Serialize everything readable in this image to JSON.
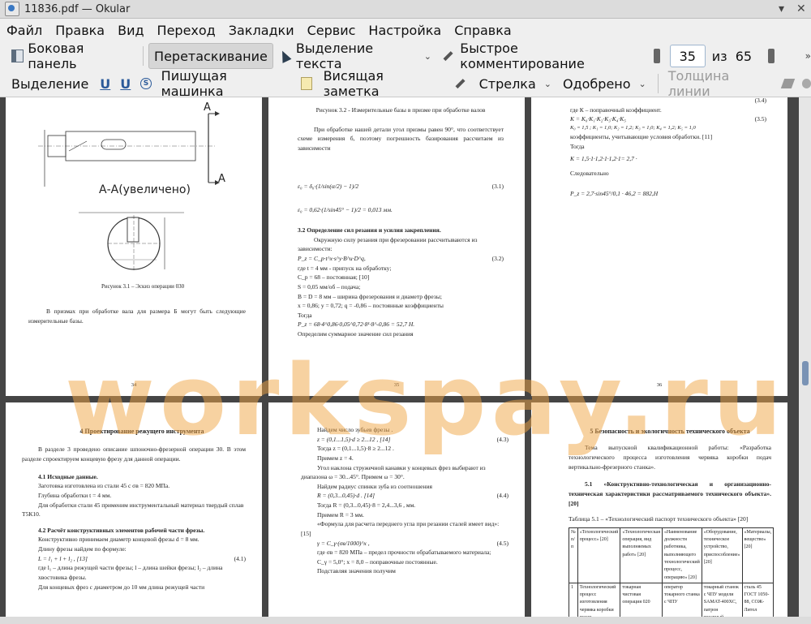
{
  "window": {
    "title": "11836.pdf — Okular"
  },
  "menu": [
    "Файл",
    "Правка",
    "Вид",
    "Переход",
    "Закладки",
    "Сервис",
    "Настройка",
    "Справка"
  ],
  "toolbar": {
    "sidebar": "Боковая панель",
    "browse": "Перетаскивание",
    "text_select": "Выделение текста",
    "quick_comment": "Быстрое комментирование",
    "page_current": "35",
    "page_of": "из",
    "page_total": "65"
  },
  "annotbar": {
    "select": "Выделение",
    "typewriter": "Пишущая машинка",
    "note": "Висящая заметка",
    "arrow": "Стрелка",
    "stamp": "Одобрено",
    "line_width": "Толщина линии"
  },
  "watermark": "workspay.ru",
  "pages": {
    "p34": {
      "number": "34",
      "section_label": "А",
      "section_title": "А-А(увеличено)",
      "caption": "Рисунок 3.1 – Эскиз операции 030",
      "text": "В призмах при обработке вала для размера Б могут быть следующие измерительные базы."
    },
    "p35": {
      "number": "35",
      "caption": "Рисунок 3.2 - Измерительные базы в призме при обработке валов",
      "para1": "При обработке нашей детали угол призмы равен 90°, что соответствует схеме измерения б, поэтому погрешность базирования рассчитаем из зависимости",
      "eq1_num": "(3.1)",
      "eq1_val": "ε₀ = 0,62·(1/sin45° − 1)/2 = 0,013 мм.",
      "heading": "3.2  Определение сил резания и усилия закрепления.",
      "para2": "Окружную силу резания при фрезеровании рассчитываются из зависимости:",
      "eq2_num": "(3.2)",
      "eq2": "P_z = C_p·t^x·s^y·B^u·D^q,",
      "list1": "где t = 4 мм - припуск на обработку;",
      "list2": "C_p = 68 – постоянная; [10]",
      "list3": "S = 0,05  мм/об – подача;",
      "list4": "B = D = 8 мм – ширина фрезерования и диаметр фрезы;",
      "list5": "x = 0,86; y = 0,72; q = -0,86 – постоянные коэффициенты",
      "then": "Тогда",
      "result": "P_z = 68·4^0,86·0,05^0,72·8¹·8^-0,86 = 52,7 Н.",
      "last": "Определим суммарное значение сил резания"
    },
    "p36": {
      "number": "36",
      "eq_num_top": "(3.4)",
      "line1": "где К – поправочный коэффициент.",
      "eq5_num": "(3.5)",
      "k_vals": "K₀ = 1,5 ; K₁ = 1,0; K₂ = 1,2; K₃ = 1,0; K₄ = 1,2; K₅ = 1,0",
      "line2": "коэффициенты, учитывающие условия обработки. [11]",
      "then": "Тогда",
      "k_result": "K = 1,5·1·1,2·1·1,2·1= 2,7 ·",
      "follows": "Следовательно",
      "final": "P_z = 2,7·sin45°/0,1 · 46,2 = 882,Н"
    },
    "p37": {
      "heading": "4  Проектирование режущего инструмента",
      "intro": "В разделе 3 проведено описание шпоночно-фрезерной операции 30. В этом разделе спроектируем концевую фрезу для данной операции.",
      "h41": "4.1 Исходные данные.",
      "l1": "Заготовка изготовлена из стали 45 с σв = 820  МПа.",
      "l2": "Глубина обработки t = 4 мм.",
      "l3": "Для обработки стали 45 применим инструментальный материал твердый сплав Т5К10.",
      "h42": "4.2  Расчёт конструктивных элементов рабочей части фрезы.",
      "l4": "Конструктивно принимаем диаметр концевой фрезы  d = 8 мм.",
      "l5": "Длину фрезы найдем по формуле:",
      "eq": "L = l₁ + l + l₂ ,  [13]",
      "eq_num": "(4.1)",
      "l6": "где l₁ – длина режущей части фрезы; l – длина шейки фрезы; l₂ – длина хвостовика фрезы.",
      "l7": "Для концевых фрез с диаметром до 10 мм длина режущей части"
    },
    "p38": {
      "l1": "Найдем число зубьев фрезы .",
      "eq1": "z = (0,1...1,5)·d ≥ 2...12 ,       [14]",
      "eq1_num": "(4.3)",
      "l2": "Тогда  z = (0,1...1,5)·8 ≥ 2...12 .",
      "l3": "Примем  z = 4.",
      "l4": "Угол наклона стружечной канавки у концевых фрез выбирают из диапазона ω = 30...45°. Примем ω = 30°.",
      "l5": "Найдем радиус спинки зуба из соотношения",
      "eq2": "R = (0,3...0,45)·d .      [14]",
      "eq2_num": "(4.4)",
      "l6": "Тогда  R = (0,3...0,45)·8 = 2,4...3,6 , мм.",
      "l7": "Примем R = 3 мм.",
      "l8": "«Формула для расчета переднего угла при резании сталей имеет вид»: [15]",
      "eq3": "γ = C_γ·(σв/1000)^x ,",
      "eq3_num": "(4.5)",
      "l9": "где σв = 820  МПа – предел прочности обрабатываемого материала;",
      "l10": "C_γ = 5,0°; x = 8,0 – поправочные постоянные.",
      "l11": "Подставляя значения получим"
    },
    "p39": {
      "heading": "5  Безопасность и экологичность технического объекта",
      "intro": "Тема выпускной квалификационной работы: «Разработка технологического процесса изготовления червяка коробки подач вертикально-фрезерного станка».",
      "h51": "5.1  «Конструктивно-технологическая и организационно-техническая характеристики рассматриваемого технического объекта». [20]",
      "table_caption": "Таблица 5.1 – «Технологический паспорт технического объекта» [20]",
      "table_head": [
        "№ п/п",
        "«Технологический процесс» [20]",
        "«Технологическая операция, вид выполняемых работ» [20]",
        "«Наименование должности работника, выполняющего технологический процесс, операцию» [20]",
        "«Оборудование, техническое устройство, приспособление» [20]",
        "«Материалы, вещество» [20]"
      ],
      "table_row": [
        "1",
        "Технологический процесс изготовления червяка коробки подач вертикально-",
        "токарная чистовая операция 020",
        "оператор токарного станка с ЧПУ",
        "токарный станок с ЧПУ модели SAMAT-400XC, патрон токарный,",
        "сталь 45 ГОСТ 1050-88, СОЖ-Литол"
      ]
    }
  }
}
